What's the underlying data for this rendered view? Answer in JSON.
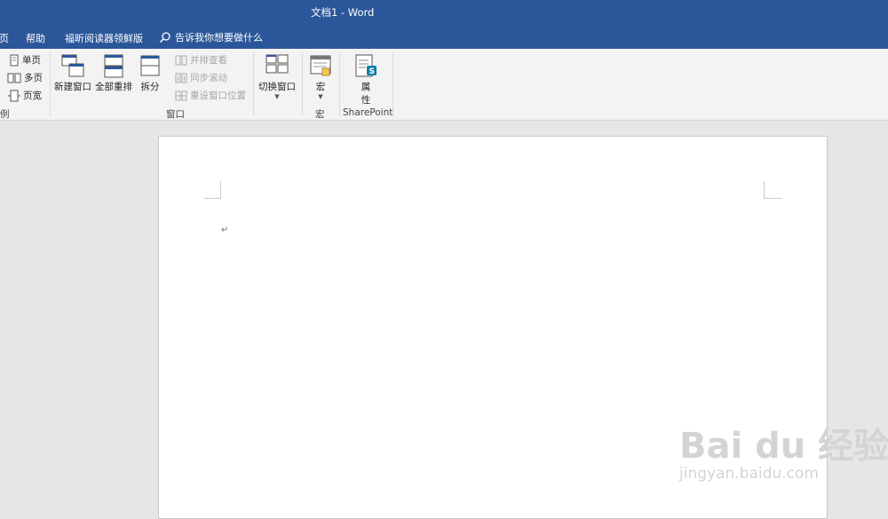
{
  "titlebar": {
    "title": "文档1  -  Word"
  },
  "menu": {
    "items": [
      "页",
      "帮助",
      "福昕阅读器领鲜版"
    ],
    "tell_me": "告诉我你想要做什么"
  },
  "ribbon": {
    "zoom_group": {
      "single_page": "单页",
      "multi_page": "多页",
      "page_width": "页宽",
      "label": "例"
    },
    "window_group": {
      "new_window": "新建窗口",
      "arrange_all": "全部重排",
      "split": "拆分",
      "side_by_side": "并排查看",
      "sync_scroll": "同步滚动",
      "reset_position": "重设窗口位置",
      "switch_windows": "切换窗口",
      "label": "窗口"
    },
    "macros_group": {
      "macros": "宏",
      "label": "宏"
    },
    "sharepoint_group": {
      "properties_line1": "属",
      "properties_line2": "性",
      "label": "SharePoint"
    }
  },
  "document": {
    "paragraph_mark": "↵"
  },
  "watermark": {
    "line1": "Bai du 经验",
    "line2": "jingyan.baidu.com"
  },
  "colors": {
    "accent": "#2b579a",
    "ribbon_bg": "#f3f3f3",
    "canvas_bg": "#e6e6e6"
  }
}
